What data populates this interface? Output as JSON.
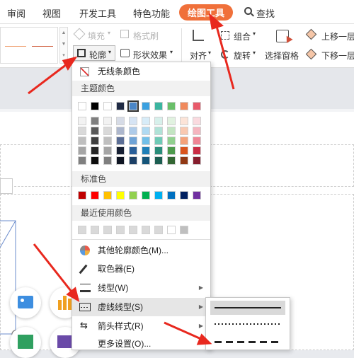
{
  "tabs": [
    {
      "label": "审阅"
    },
    {
      "label": "视图"
    },
    {
      "label": "开发工具"
    },
    {
      "label": "特色功能"
    },
    {
      "label": "绘图工具"
    },
    {
      "label": "查找"
    }
  ],
  "ribbon": {
    "fill": "填充",
    "format_brush": "格式刷",
    "outline": "轮廓",
    "shape_effect": "形状效果",
    "align": "对齐",
    "group": "组合",
    "rotate": "旋转",
    "selection_pane": "选择窗格",
    "bring_forward": "上移一层",
    "send_backward": "下移一层"
  },
  "menu": {
    "no_line_color": "无线条颜色",
    "theme_colors_title": "主题颜色",
    "standard_colors_title": "标准色",
    "recent_colors_title": "最近使用颜色",
    "other_colors": "其他轮廓颜色(M)...",
    "eyedropper": "取色器(E)",
    "line_type": "线型(W)",
    "dash_type": "虚线线型(S)",
    "arrow_style": "箭头样式(R)",
    "more_settings": "更多设置(O)..."
  },
  "theme_top": [
    "#ffffff",
    "#000000",
    "#ffffff",
    "#1f2a44",
    "#4a86c8",
    "#3aa0e0",
    "#3bb5a0",
    "#6abf69",
    "#f08a5d",
    "#e85a6a"
  ],
  "theme_grid": [
    [
      "#f2f2f2",
      "#7f7f7f",
      "#f2f2f2",
      "#d6dbe6",
      "#d6e4f4",
      "#d7ecf8",
      "#d7f0eb",
      "#e1f2e0",
      "#fce4d8",
      "#fadadf"
    ],
    [
      "#d9d9d9",
      "#595959",
      "#d9d9d9",
      "#adb7cd",
      "#aecbe9",
      "#b0daf2",
      "#b0e2d7",
      "#c3e5c2",
      "#f9c9b1",
      "#f5b5bf"
    ],
    [
      "#bfbfbf",
      "#3f3f3f",
      "#bfbfbf",
      "#5b6e96",
      "#6fa3d6",
      "#72bfe8",
      "#6fcab6",
      "#91d08f",
      "#f4a27a",
      "#ef8595"
    ],
    [
      "#a5a5a5",
      "#262626",
      "#a5a5a5",
      "#172034",
      "#2a5f99",
      "#1f7fb8",
      "#2a8d7a",
      "#4d9a4c",
      "#d9541d",
      "#c92c44"
    ],
    [
      "#7f7f7f",
      "#0d0d0d",
      "#7f7f7f",
      "#0f1523",
      "#1c3f66",
      "#15557a",
      "#1c5e51",
      "#336633",
      "#903814",
      "#861d2d"
    ]
  ],
  "standard": [
    "#c00000",
    "#ff0000",
    "#ffc000",
    "#ffff00",
    "#92d050",
    "#00b050",
    "#00b0f0",
    "#0070c0",
    "#002060",
    "#7030a0"
  ],
  "recent": [
    "#d9d9d9",
    "#d9d9d9",
    "#d9d9d9",
    "#d9d9d9",
    "#d9d9d9",
    "#d9d9d9",
    "#d9d9d9",
    "#ffffff",
    "#bfbfbf"
  ],
  "accent": "#f0703a"
}
